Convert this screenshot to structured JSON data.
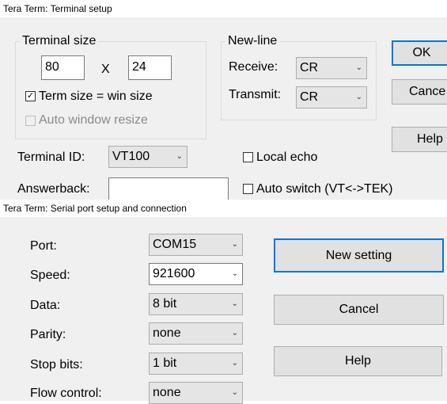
{
  "terminal": {
    "title": "Tera Term: Terminal setup",
    "size_group": "Terminal size",
    "cols": "80",
    "x_symbol": "X",
    "rows": "24",
    "term_size_label": "Term size = win size",
    "term_size_checked": true,
    "auto_resize_label": "Auto window resize",
    "auto_resize_checked": false,
    "newline_group": "New-line",
    "receive_label": "Receive:",
    "receive_value": "CR",
    "transmit_label": "Transmit:",
    "transmit_value": "CR",
    "ok_label": "OK",
    "cancel_label": "Cance",
    "help_label": "Help",
    "terminal_id_label": "Terminal ID:",
    "terminal_id_value": "VT100",
    "local_echo_label": "Local echo",
    "answerback_label": "Answerback:",
    "answerback_value": "",
    "auto_switch_label": "Auto switch (VT<->TEK)"
  },
  "serial": {
    "title": "Tera Term: Serial port setup and connection",
    "port_label": "Port:",
    "port_value": "COM15",
    "speed_label": "Speed:",
    "speed_value": "921600",
    "data_label": "Data:",
    "data_value": "8 bit",
    "parity_label": "Parity:",
    "parity_value": "none",
    "stop_label": "Stop bits:",
    "stop_value": "1 bit",
    "flow_label": "Flow control:",
    "flow_value": "none",
    "new_setting_label": "New setting",
    "cancel_label": "Cancel",
    "help_label": "Help"
  },
  "icons": {
    "dropdown": "chevron-down-icon",
    "check": "checkmark-icon"
  },
  "colors": {
    "dialog_bg": "#f0f0f0",
    "focus_border": "#0078d7",
    "disabled_text": "#8a8a8a"
  }
}
